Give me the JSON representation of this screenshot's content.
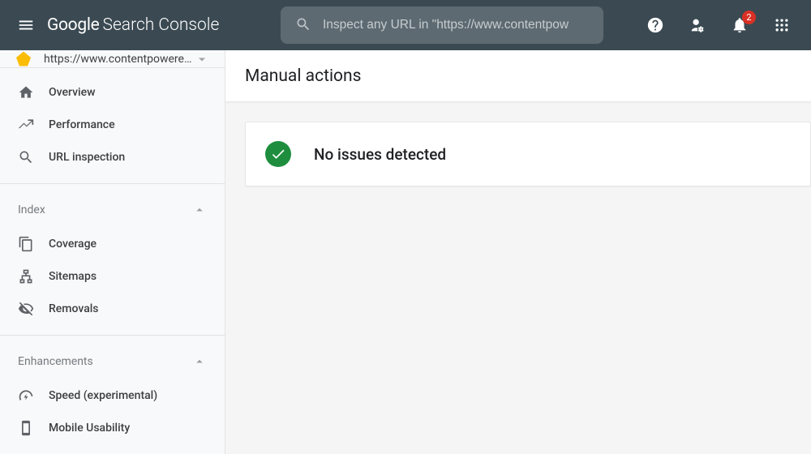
{
  "header": {
    "logo_google": "Google",
    "logo_sc": "Search Console",
    "search_placeholder": "Inspect any URL in \"https://www.contentpow",
    "notification_count": "2"
  },
  "sidebar": {
    "property_label": "https://www.contentpowered…",
    "main_items": [
      {
        "label": "Overview"
      },
      {
        "label": "Performance"
      },
      {
        "label": "URL inspection"
      }
    ],
    "index_section": {
      "title": "Index",
      "items": [
        {
          "label": "Coverage"
        },
        {
          "label": "Sitemaps"
        },
        {
          "label": "Removals"
        }
      ]
    },
    "enh_section": {
      "title": "Enhancements",
      "items": [
        {
          "label": "Speed (experimental)"
        },
        {
          "label": "Mobile Usability"
        }
      ]
    }
  },
  "main": {
    "page_title": "Manual actions",
    "status_message": "No issues detected"
  }
}
